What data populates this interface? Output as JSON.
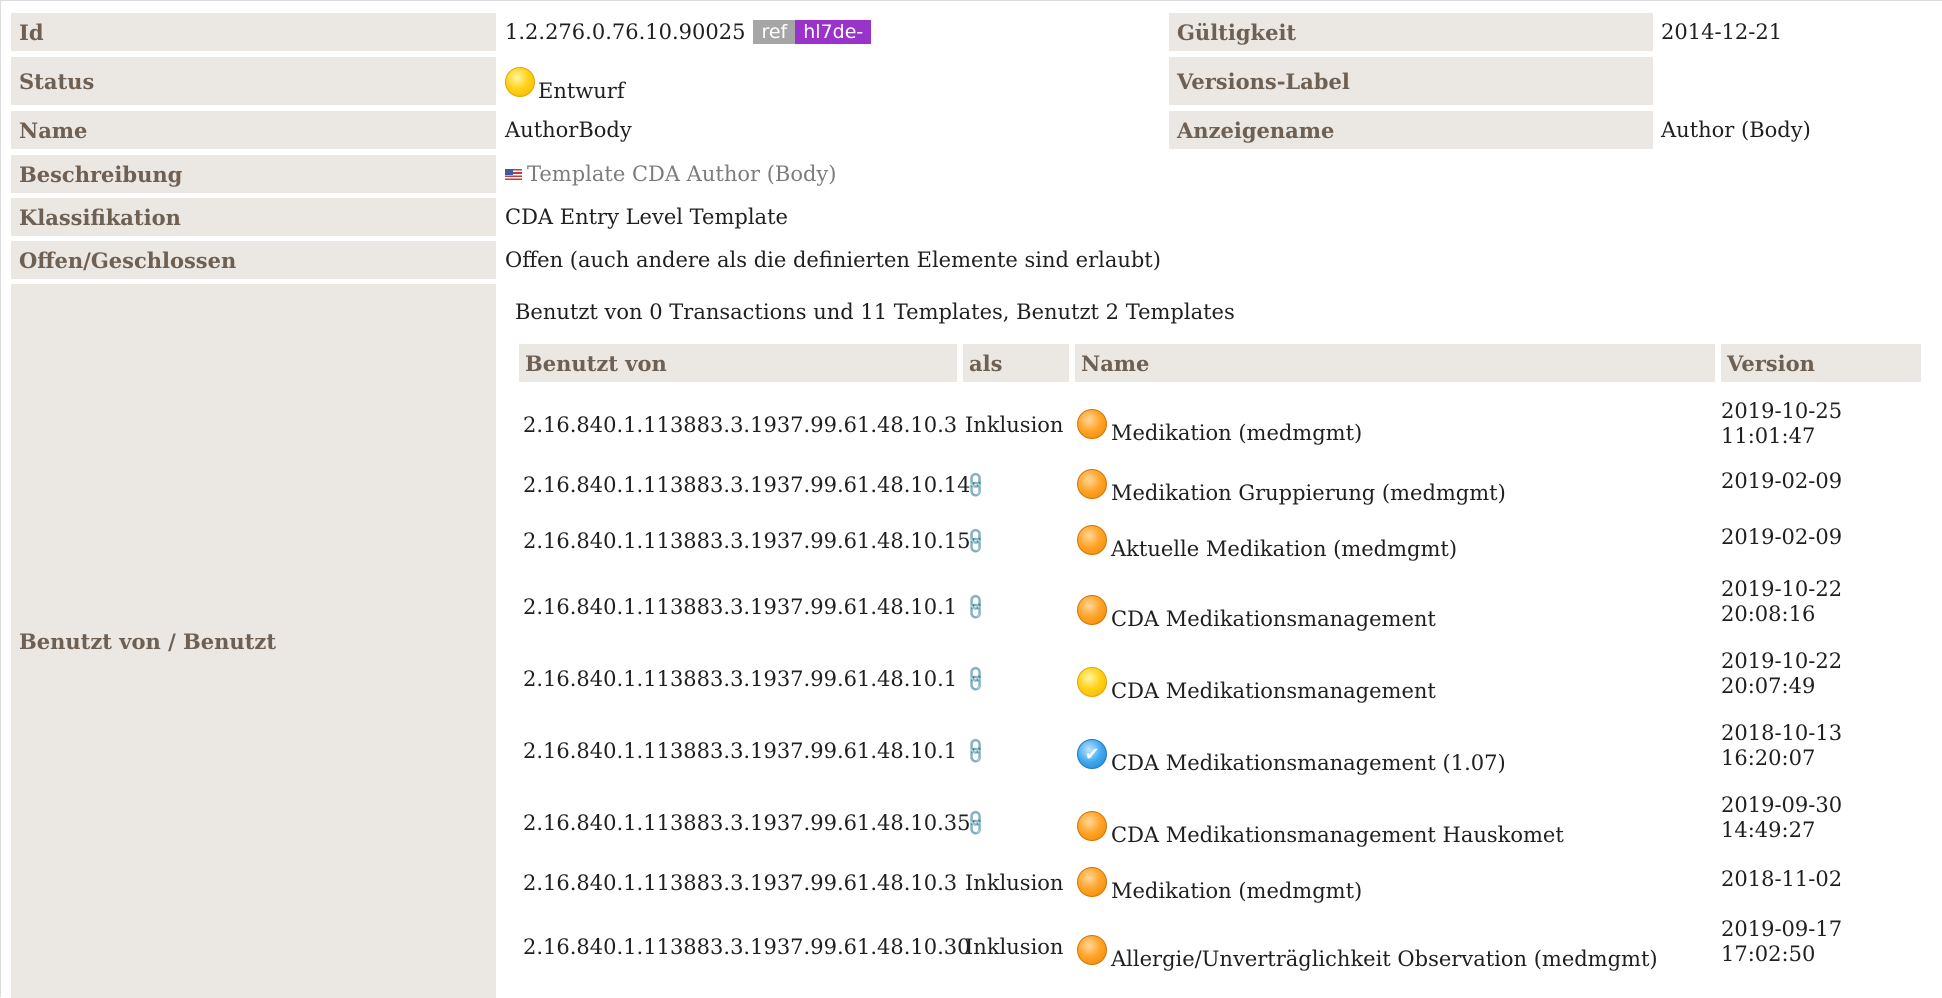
{
  "header": {
    "id_label": "Id",
    "id_value": "1.2.276.0.76.10.90025",
    "badge_ref": "ref",
    "badge_hl7": "hl7de-",
    "gueltigkeit_label": "Gültigkeit",
    "gueltigkeit_value": "2014-12-21",
    "status_label": "Status",
    "status_value": "Entwurf",
    "status_icon": "status-draft-icon",
    "versions_label": "Versions-Label",
    "name_label": "Name",
    "name_value": "AuthorBody",
    "anzeigename_label": "Anzeigename",
    "anzeigename_value": "Author (Body)",
    "beschreibung_label": "Beschreibung",
    "beschreibung_value": "Template CDA Author (Body)",
    "klassifikation_label": "Klassifikation",
    "klassifikation_value": "CDA Entry Level Template",
    "offen_label": "Offen/Geschlossen",
    "offen_value": "Offen (auch andere als die definierten Elemente sind erlaubt)",
    "benutzt_label": "Benutzt von / Benutzt"
  },
  "usage": {
    "summary": "Benutzt von 0 Transactions und 11 Templates, Benutzt 2 Templates",
    "columns": [
      "Benutzt von",
      "als",
      "Name",
      "Version"
    ],
    "rows": [
      {
        "id": "2.16.840.1.113883.3.1937.99.61.48.10.3",
        "als": "Inklusion",
        "status": "orange",
        "name": "Medikation (medmgmt)",
        "version": [
          "2019-10-25",
          "11:01:47"
        ]
      },
      {
        "id": "2.16.840.1.113883.3.1937.99.61.48.10.14",
        "als": "",
        "status": "orange",
        "name": "Medikation Gruppierung (medmgmt)",
        "version": [
          "2019-02-09"
        ]
      },
      {
        "id": "2.16.840.1.113883.3.1937.99.61.48.10.15",
        "als": "",
        "status": "orange",
        "name": "Aktuelle Medikation (medmgmt)",
        "version": [
          "2019-02-09"
        ]
      },
      {
        "id": "2.16.840.1.113883.3.1937.99.61.48.10.1",
        "als": "",
        "status": "orange",
        "name": "CDA Medikationsmanagement",
        "version": [
          "2019-10-22",
          "20:08:16"
        ]
      },
      {
        "id": "2.16.840.1.113883.3.1937.99.61.48.10.1",
        "als": "",
        "status": "yellow",
        "name": "CDA Medikationsmanagement",
        "version": [
          "2019-10-22",
          "20:07:49"
        ]
      },
      {
        "id": "2.16.840.1.113883.3.1937.99.61.48.10.1",
        "als": "",
        "status": "blue",
        "name": "CDA Medikationsmanagement (1.07)",
        "version": [
          "2018-10-13",
          "16:20:07"
        ]
      },
      {
        "id": "2.16.840.1.113883.3.1937.99.61.48.10.35",
        "als": "",
        "status": "orange",
        "name": "CDA Medikationsmanagement Hauskomet",
        "version": [
          "2019-09-30",
          "14:49:27"
        ]
      },
      {
        "id": "2.16.840.1.113883.3.1937.99.61.48.10.3",
        "als": "Inklusion",
        "status": "orange",
        "name": "Medikation (medmgmt)",
        "version": [
          "2018-11-02"
        ]
      },
      {
        "id": "2.16.840.1.113883.3.1937.99.61.48.10.30",
        "als": "Inklusion",
        "status": "orange",
        "name": "Allergie/Unverträglichkeit Observation (medmgmt)",
        "version": [
          "2019-09-17",
          "17:02:50"
        ]
      }
    ]
  },
  "icons": {
    "link": "link-icon",
    "flag": "us-flag-icon",
    "check": "check-icon"
  },
  "colors": {
    "label_bg": "#ebe7e2",
    "label_text": "#6e6052",
    "badge_ref": "#a6a6a6",
    "badge_hl7": "#9933cc",
    "link_icon": "#e37222"
  }
}
